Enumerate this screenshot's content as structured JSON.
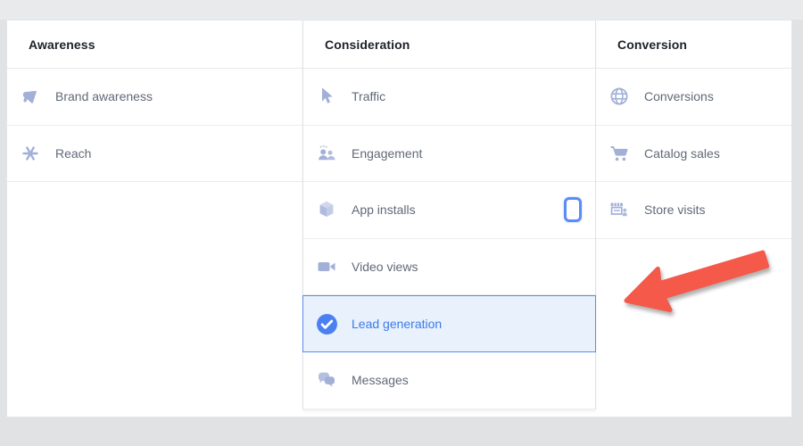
{
  "table": {
    "columns": [
      {
        "header": "Awareness",
        "items": [
          {
            "label": "Brand awareness",
            "icon": "megaphone-icon"
          },
          {
            "label": "Reach",
            "icon": "reach-asterisk-icon"
          }
        ]
      },
      {
        "header": "Consideration",
        "items": [
          {
            "label": "Traffic",
            "icon": "cursor-icon"
          },
          {
            "label": "Engagement",
            "icon": "people-icon"
          },
          {
            "label": "App installs",
            "icon": "cube-icon",
            "trailing_icon": "mobile-device-icon"
          },
          {
            "label": "Video views",
            "icon": "video-camera-icon"
          },
          {
            "label": "Lead generation",
            "icon": "check-circle-icon",
            "selected": true
          },
          {
            "label": "Messages",
            "icon": "chat-bubbles-icon"
          }
        ]
      },
      {
        "header": "Conversion",
        "items": [
          {
            "label": "Conversions",
            "icon": "globe-icon"
          },
          {
            "label": "Catalog sales",
            "icon": "shopping-cart-icon"
          },
          {
            "label": "Store visits",
            "icon": "storefront-icon"
          }
        ]
      }
    ]
  },
  "selection": {
    "selected_label": "Lead generation"
  },
  "annotation": {
    "type": "red-arrow",
    "arrow_color": "#f4594a"
  },
  "colors": {
    "accent_blue": "#3b7cea",
    "selected_bg": "#e8f1fc",
    "selected_border": "#5a8cf2",
    "icon_blue": "#a2b0d8",
    "check_circle_blue": "#4a80f2",
    "header_text": "#1d2129",
    "item_text": "#616977",
    "background_gray": "#e1e2e4"
  }
}
